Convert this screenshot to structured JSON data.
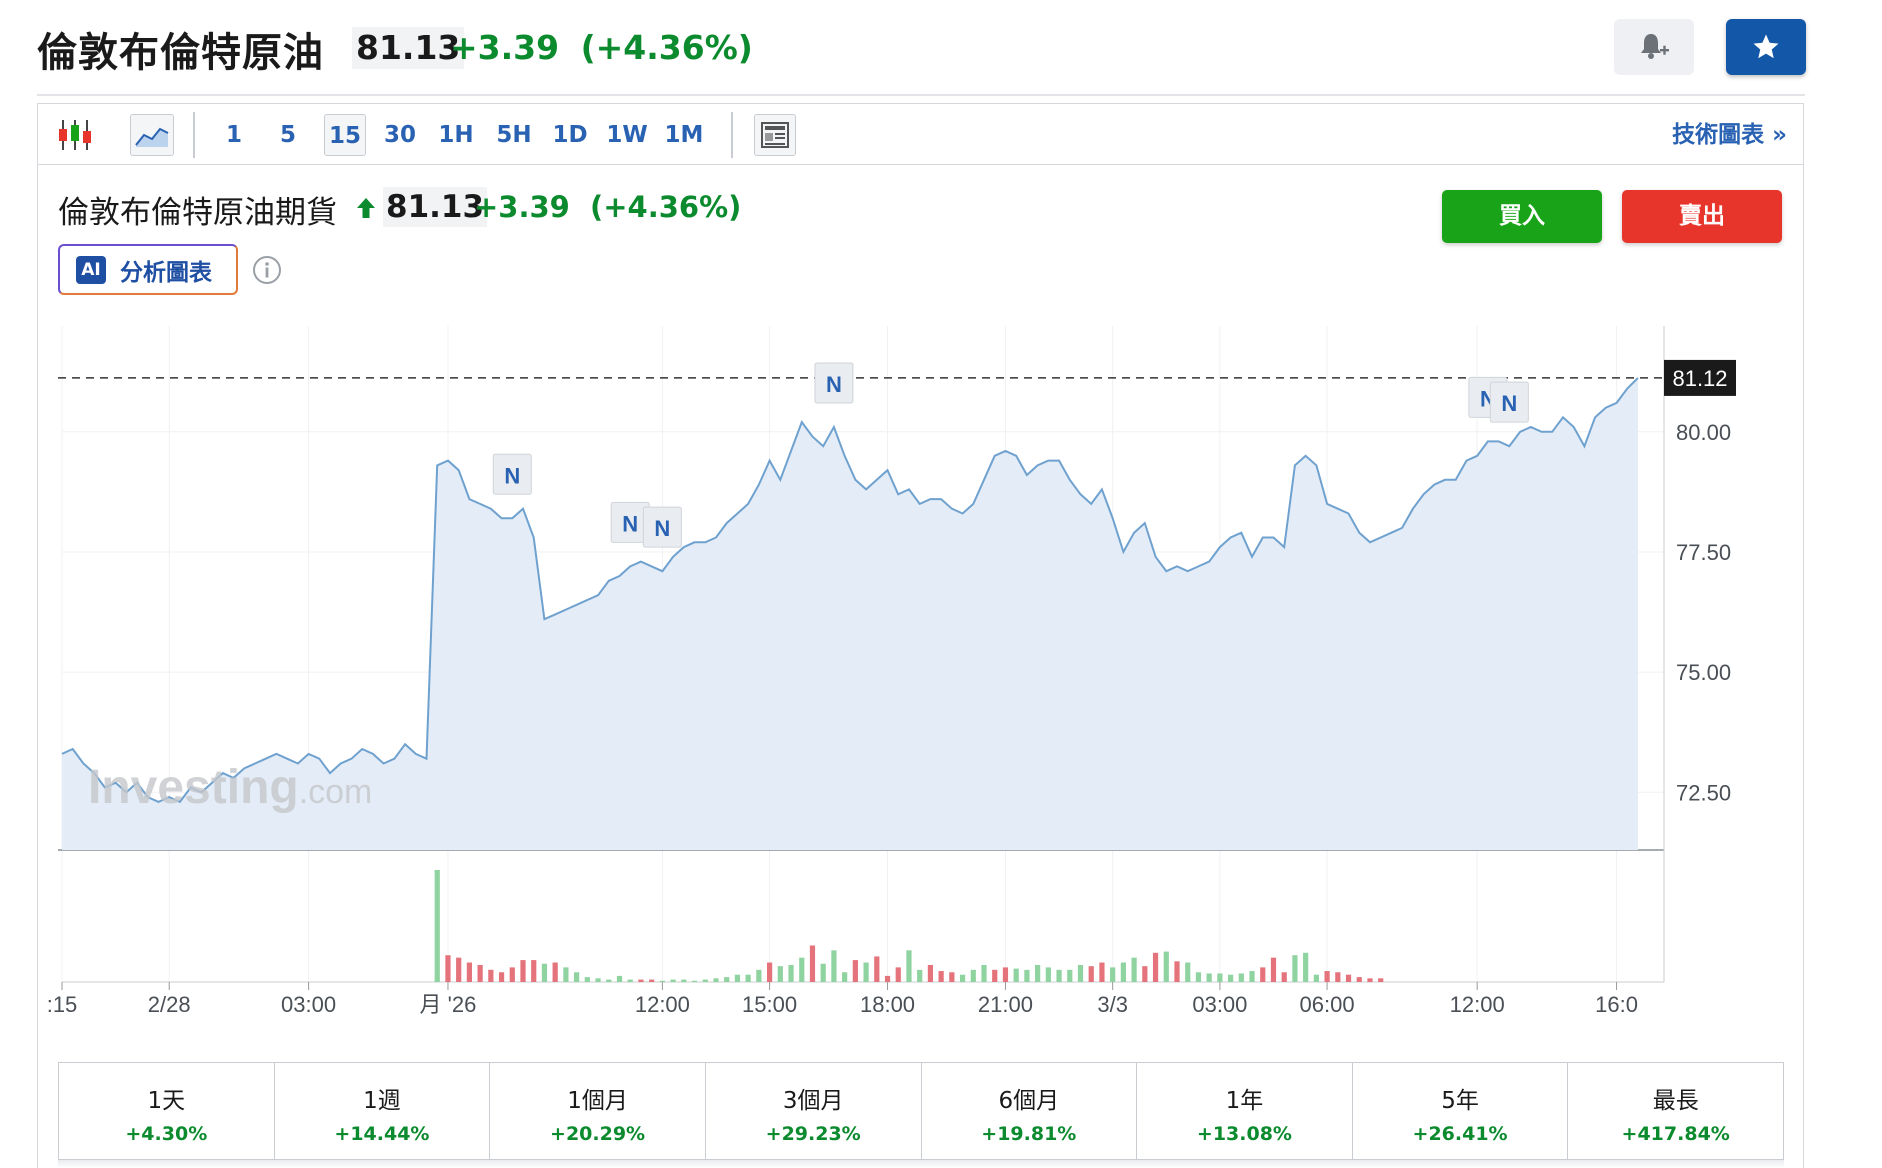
{
  "header": {
    "title": "倫敦布倫特原油",
    "price": "81.13",
    "change": "+3.39",
    "change_pct": "(+4.36%)"
  },
  "toolbar": {
    "timeframes": [
      "1",
      "5",
      "15",
      "30",
      "1H",
      "5H",
      "1D",
      "1W",
      "1M"
    ],
    "active_timeframe": "15",
    "tech_link": "技術圖表 »"
  },
  "subheader": {
    "title": "倫敦布倫特原油期貨",
    "price": "81.13",
    "change": "+3.39",
    "change_pct": "(+4.36%)",
    "buy_label": "買入",
    "sell_label": "賣出",
    "ai_badge": "AI",
    "ai_label": "分析圖表"
  },
  "chart_data": {
    "type": "area",
    "watermark": "Investing",
    "watermark_suffix": ".com",
    "last_value": "81.12",
    "y_ticks": [
      "80.00",
      "77.50",
      "75.00",
      "72.50"
    ],
    "y_tick_values": [
      80.0,
      77.5,
      75.0,
      72.5
    ],
    "ylim": [
      71.3,
      82.2
    ],
    "x_ticks": [
      ":15",
      "2/28",
      "03:00",
      "月 '26",
      "12:00",
      "15:00",
      "18:00",
      "21:00",
      "3/3",
      "03:00",
      "06:00",
      "12:00",
      "16:0"
    ],
    "x_tick_index": [
      0,
      10,
      23,
      36,
      56,
      66,
      77,
      88,
      98,
      108,
      118,
      132,
      145
    ],
    "news_marker_label": "N",
    "news_marker_index": [
      42,
      53,
      56,
      72,
      133,
      135
    ],
    "values": [
      73.3,
      73.4,
      73.1,
      72.9,
      72.6,
      72.7,
      72.5,
      72.7,
      72.4,
      72.3,
      72.4,
      72.3,
      72.6,
      72.5,
      72.7,
      72.9,
      72.8,
      73.0,
      73.1,
      73.2,
      73.3,
      73.2,
      73.1,
      73.3,
      73.2,
      72.9,
      73.1,
      73.2,
      73.4,
      73.3,
      73.1,
      73.2,
      73.5,
      73.3,
      73.2,
      79.3,
      79.4,
      79.2,
      78.6,
      78.5,
      78.4,
      78.2,
      78.2,
      78.4,
      77.8,
      76.1,
      76.2,
      76.3,
      76.4,
      76.5,
      76.6,
      76.9,
      77.0,
      77.2,
      77.3,
      77.2,
      77.1,
      77.4,
      77.6,
      77.7,
      77.7,
      77.8,
      78.1,
      78.3,
      78.5,
      78.9,
      79.4,
      79.0,
      79.6,
      80.2,
      79.9,
      79.7,
      80.1,
      79.5,
      79.0,
      78.8,
      79.0,
      79.2,
      78.7,
      78.8,
      78.5,
      78.6,
      78.6,
      78.4,
      78.3,
      78.5,
      79.0,
      79.5,
      79.6,
      79.5,
      79.1,
      79.3,
      79.4,
      79.4,
      79.0,
      78.7,
      78.5,
      78.8,
      78.2,
      77.5,
      77.9,
      78.1,
      77.4,
      77.1,
      77.2,
      77.1,
      77.2,
      77.3,
      77.6,
      77.8,
      77.9,
      77.4,
      77.8,
      77.8,
      77.6,
      79.3,
      79.5,
      79.3,
      78.5,
      78.4,
      78.3,
      77.9,
      77.7,
      77.8,
      77.9,
      78.0,
      78.4,
      78.7,
      78.9,
      79.0,
      79.0,
      79.4,
      79.5,
      79.8,
      79.8,
      79.7,
      80.0,
      80.1,
      80.0,
      80.0,
      80.3,
      80.1,
      79.7,
      80.3,
      80.5,
      80.6,
      80.9,
      81.12
    ],
    "volume": [
      0,
      0,
      0,
      0,
      0,
      0,
      0,
      0,
      0,
      0,
      0,
      0,
      0,
      0,
      0,
      0,
      0,
      0,
      0,
      0,
      0,
      0,
      0,
      0,
      0,
      0,
      0,
      0,
      0,
      0,
      0,
      0,
      0,
      0,
      0,
      92,
      22,
      20,
      16,
      14,
      10,
      8,
      12,
      18,
      18,
      15,
      16,
      12,
      8,
      4,
      3,
      2,
      5,
      2,
      2,
      2,
      1,
      2,
      2,
      1,
      2,
      3,
      4,
      6,
      6,
      10,
      16,
      13,
      14,
      20,
      30,
      15,
      26,
      8,
      18,
      16,
      21,
      5,
      12,
      26,
      10,
      14,
      9,
      8,
      6,
      10,
      14,
      10,
      12,
      11,
      10,
      14,
      12,
      10,
      10,
      14,
      13,
      16,
      12,
      16,
      20,
      13,
      24,
      25,
      17,
      16,
      8,
      7,
      7,
      6,
      7,
      9,
      12,
      20,
      8,
      22,
      24,
      6,
      9,
      8,
      6,
      4,
      3,
      3
    ],
    "volume_up": [
      0,
      0,
      0,
      0,
      0,
      0,
      0,
      0,
      0,
      0,
      0,
      0,
      0,
      0,
      0,
      0,
      0,
      0,
      0,
      0,
      0,
      0,
      0,
      0,
      0,
      0,
      0,
      0,
      0,
      0,
      0,
      0,
      0,
      0,
      0,
      1,
      0,
      0,
      0,
      0,
      0,
      0,
      0,
      0,
      0,
      1,
      0,
      1,
      1,
      1,
      1,
      1,
      1,
      1,
      0,
      0,
      1,
      1,
      1,
      1,
      1,
      1,
      1,
      1,
      1,
      1,
      0,
      1,
      1,
      1,
      0,
      1,
      1,
      1,
      0,
      1,
      0,
      0,
      0,
      1,
      1,
      0,
      0,
      0,
      1,
      1,
      1,
      0,
      0,
      1,
      1,
      1,
      1,
      1,
      1,
      1,
      0,
      0,
      1,
      1,
      1,
      0,
      0,
      1,
      0,
      1,
      1,
      1,
      1,
      1,
      1,
      1,
      0,
      0,
      0,
      1,
      1,
      1,
      0,
      0,
      0,
      0,
      0,
      0
    ]
  },
  "performance": [
    {
      "label": "1天",
      "value": "+4.30%"
    },
    {
      "label": "1週",
      "value": "+14.44%"
    },
    {
      "label": "1個月",
      "value": "+20.29%"
    },
    {
      "label": "3個月",
      "value": "+29.23%"
    },
    {
      "label": "6個月",
      "value": "+19.81%"
    },
    {
      "label": "1年",
      "value": "+13.08%"
    },
    {
      "label": "5年",
      "value": "+26.41%"
    },
    {
      "label": "最長",
      "value": "+417.84%"
    }
  ],
  "colors": {
    "up": "#0b8a2e",
    "down": "#e8352b",
    "line": "#6fa1cf",
    "area": "#e4edf7",
    "vol_up": "#8fd3a0",
    "vol_down": "#e4737b",
    "accent": "#1257a8"
  }
}
